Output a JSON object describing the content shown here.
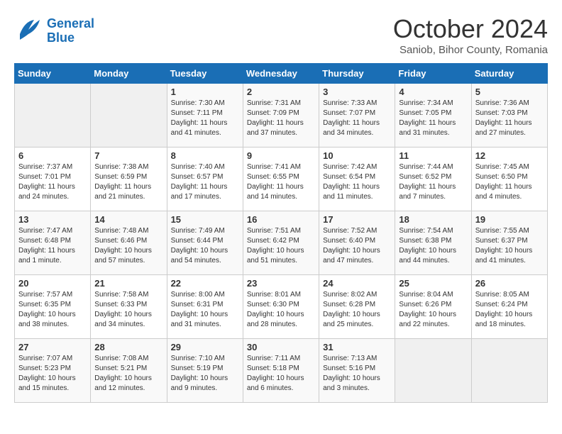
{
  "header": {
    "logo_line1": "General",
    "logo_line2": "Blue",
    "month": "October 2024",
    "location": "Saniob, Bihor County, Romania"
  },
  "weekdays": [
    "Sunday",
    "Monday",
    "Tuesday",
    "Wednesday",
    "Thursday",
    "Friday",
    "Saturday"
  ],
  "weeks": [
    [
      {
        "day": "",
        "info": ""
      },
      {
        "day": "",
        "info": ""
      },
      {
        "day": "1",
        "info": "Sunrise: 7:30 AM\nSunset: 7:11 PM\nDaylight: 11 hours and 41 minutes."
      },
      {
        "day": "2",
        "info": "Sunrise: 7:31 AM\nSunset: 7:09 PM\nDaylight: 11 hours and 37 minutes."
      },
      {
        "day": "3",
        "info": "Sunrise: 7:33 AM\nSunset: 7:07 PM\nDaylight: 11 hours and 34 minutes."
      },
      {
        "day": "4",
        "info": "Sunrise: 7:34 AM\nSunset: 7:05 PM\nDaylight: 11 hours and 31 minutes."
      },
      {
        "day": "5",
        "info": "Sunrise: 7:36 AM\nSunset: 7:03 PM\nDaylight: 11 hours and 27 minutes."
      }
    ],
    [
      {
        "day": "6",
        "info": "Sunrise: 7:37 AM\nSunset: 7:01 PM\nDaylight: 11 hours and 24 minutes."
      },
      {
        "day": "7",
        "info": "Sunrise: 7:38 AM\nSunset: 6:59 PM\nDaylight: 11 hours and 21 minutes."
      },
      {
        "day": "8",
        "info": "Sunrise: 7:40 AM\nSunset: 6:57 PM\nDaylight: 11 hours and 17 minutes."
      },
      {
        "day": "9",
        "info": "Sunrise: 7:41 AM\nSunset: 6:55 PM\nDaylight: 11 hours and 14 minutes."
      },
      {
        "day": "10",
        "info": "Sunrise: 7:42 AM\nSunset: 6:54 PM\nDaylight: 11 hours and 11 minutes."
      },
      {
        "day": "11",
        "info": "Sunrise: 7:44 AM\nSunset: 6:52 PM\nDaylight: 11 hours and 7 minutes."
      },
      {
        "day": "12",
        "info": "Sunrise: 7:45 AM\nSunset: 6:50 PM\nDaylight: 11 hours and 4 minutes."
      }
    ],
    [
      {
        "day": "13",
        "info": "Sunrise: 7:47 AM\nSunset: 6:48 PM\nDaylight: 11 hours and 1 minute."
      },
      {
        "day": "14",
        "info": "Sunrise: 7:48 AM\nSunset: 6:46 PM\nDaylight: 10 hours and 57 minutes."
      },
      {
        "day": "15",
        "info": "Sunrise: 7:49 AM\nSunset: 6:44 PM\nDaylight: 10 hours and 54 minutes."
      },
      {
        "day": "16",
        "info": "Sunrise: 7:51 AM\nSunset: 6:42 PM\nDaylight: 10 hours and 51 minutes."
      },
      {
        "day": "17",
        "info": "Sunrise: 7:52 AM\nSunset: 6:40 PM\nDaylight: 10 hours and 47 minutes."
      },
      {
        "day": "18",
        "info": "Sunrise: 7:54 AM\nSunset: 6:38 PM\nDaylight: 10 hours and 44 minutes."
      },
      {
        "day": "19",
        "info": "Sunrise: 7:55 AM\nSunset: 6:37 PM\nDaylight: 10 hours and 41 minutes."
      }
    ],
    [
      {
        "day": "20",
        "info": "Sunrise: 7:57 AM\nSunset: 6:35 PM\nDaylight: 10 hours and 38 minutes."
      },
      {
        "day": "21",
        "info": "Sunrise: 7:58 AM\nSunset: 6:33 PM\nDaylight: 10 hours and 34 minutes."
      },
      {
        "day": "22",
        "info": "Sunrise: 8:00 AM\nSunset: 6:31 PM\nDaylight: 10 hours and 31 minutes."
      },
      {
        "day": "23",
        "info": "Sunrise: 8:01 AM\nSunset: 6:30 PM\nDaylight: 10 hours and 28 minutes."
      },
      {
        "day": "24",
        "info": "Sunrise: 8:02 AM\nSunset: 6:28 PM\nDaylight: 10 hours and 25 minutes."
      },
      {
        "day": "25",
        "info": "Sunrise: 8:04 AM\nSunset: 6:26 PM\nDaylight: 10 hours and 22 minutes."
      },
      {
        "day": "26",
        "info": "Sunrise: 8:05 AM\nSunset: 6:24 PM\nDaylight: 10 hours and 18 minutes."
      }
    ],
    [
      {
        "day": "27",
        "info": "Sunrise: 7:07 AM\nSunset: 5:23 PM\nDaylight: 10 hours and 15 minutes."
      },
      {
        "day": "28",
        "info": "Sunrise: 7:08 AM\nSunset: 5:21 PM\nDaylight: 10 hours and 12 minutes."
      },
      {
        "day": "29",
        "info": "Sunrise: 7:10 AM\nSunset: 5:19 PM\nDaylight: 10 hours and 9 minutes."
      },
      {
        "day": "30",
        "info": "Sunrise: 7:11 AM\nSunset: 5:18 PM\nDaylight: 10 hours and 6 minutes."
      },
      {
        "day": "31",
        "info": "Sunrise: 7:13 AM\nSunset: 5:16 PM\nDaylight: 10 hours and 3 minutes."
      },
      {
        "day": "",
        "info": ""
      },
      {
        "day": "",
        "info": ""
      }
    ]
  ]
}
